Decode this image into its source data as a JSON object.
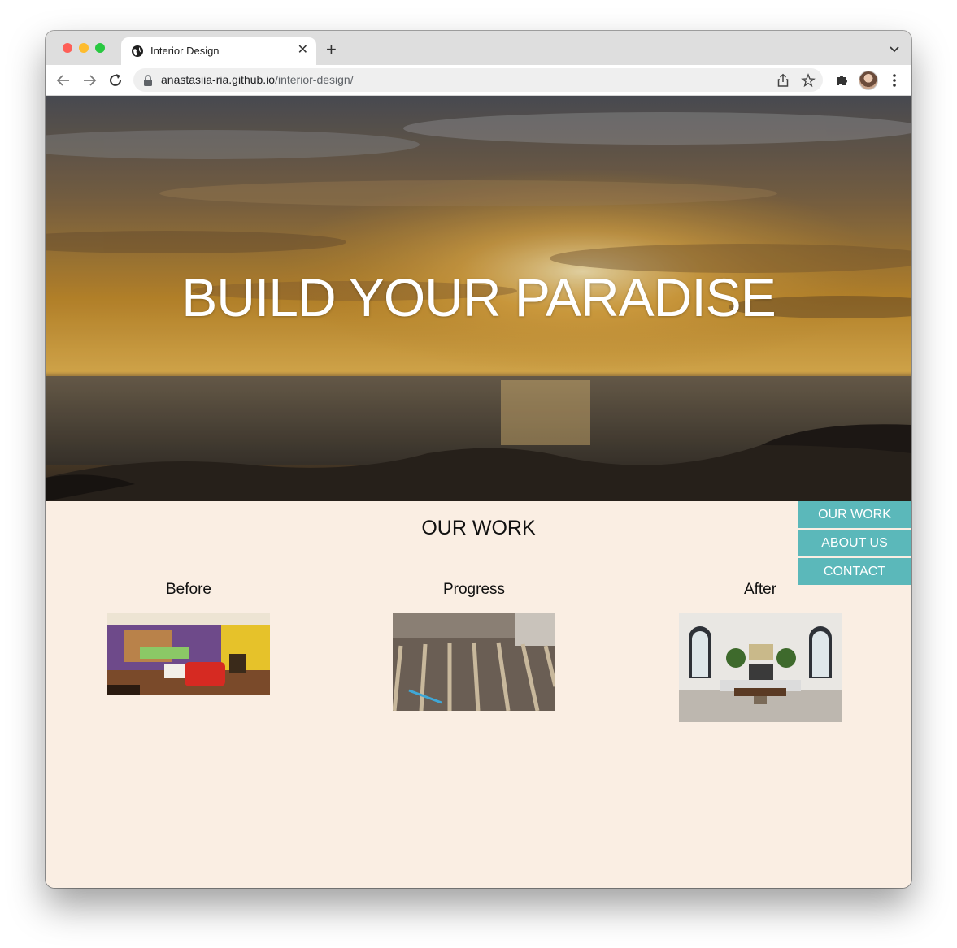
{
  "browser": {
    "tab_title": "Interior Design",
    "new_tab_glyph": "+",
    "close_glyph": "✕",
    "url_host": "anastasiia-ria.github.io",
    "url_path": "/interior-design/",
    "icons": [
      "globe-icon",
      "back-arrow-icon",
      "forward-arrow-icon",
      "reload-icon",
      "lock-icon",
      "share-icon",
      "bookmark-star-icon",
      "extensions-puzzle-icon",
      "profile-avatar",
      "kebab-menu-icon",
      "tab-list-chevron-icon"
    ]
  },
  "hero": {
    "title": "BUILD YOUR PARADISE"
  },
  "work": {
    "title": "OUR WORK",
    "columns": [
      {
        "label": "Before",
        "image": "colorful cluttered kitchen and living room"
      },
      {
        "label": "Progress",
        "image": "exposed floor joists during renovation"
      },
      {
        "label": "After",
        "image": "bright renovated living room with arched windows"
      }
    ]
  },
  "sidenav": {
    "items": [
      "OUR WORK",
      "ABOUT US",
      "CONTACT"
    ],
    "color": "#5bb8ba"
  },
  "colors": {
    "page_background": "#faeee3",
    "nav_accent": "#5bb8ba"
  }
}
